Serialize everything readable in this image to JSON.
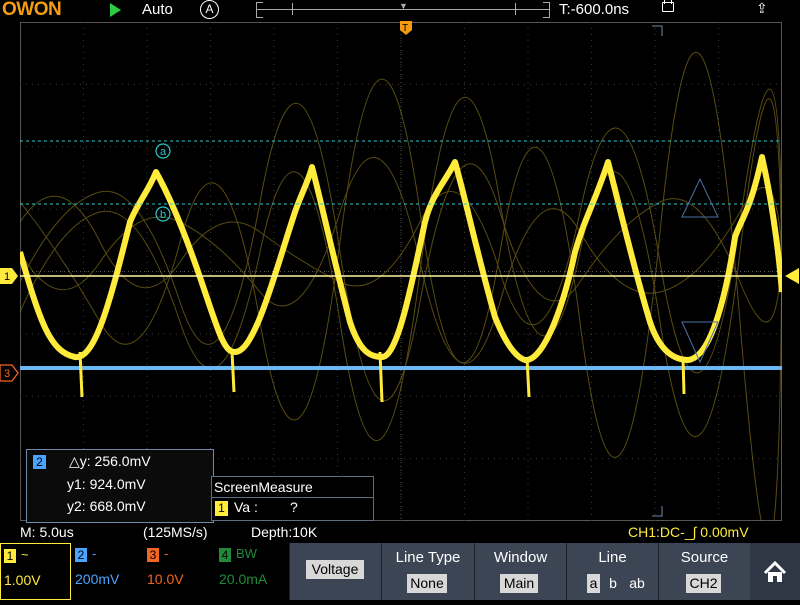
{
  "topbar": {
    "logo": "OWON",
    "trigger_mode": "Auto",
    "acquire_mode": "A",
    "trigger_position": "T:-600.0ns"
  },
  "markers": {
    "trigger": "T",
    "ch1": "1",
    "ch3": "3",
    "cursor_a": "a",
    "cursor_b": "b"
  },
  "cursor_readout": {
    "channel": "2",
    "dy": "△y: 256.0mV",
    "y1": "y1: 924.0mV",
    "y2": "y2: 668.0mV"
  },
  "screen_measure": {
    "title": "ScreenMeasure",
    "channel": "1",
    "label": "Va :",
    "value": "?"
  },
  "status": {
    "timebase": "M: 5.0us",
    "sample_rate": "(125MS/s)",
    "depth": "Depth:10K",
    "trigger_info": "CH1:DC-_∫ 0.00mV"
  },
  "channels": [
    {
      "num": "1",
      "coupling": "~",
      "scale": "1.00V",
      "color": "#ffeb3b"
    },
    {
      "num": "2",
      "coupling": "-",
      "scale": "200mV",
      "color": "#4aa3ff"
    },
    {
      "num": "3",
      "coupling": "-",
      "scale": "10.0V",
      "color": "#f26522"
    },
    {
      "num": "4",
      "coupling": "BW",
      "scale": "20.0mA",
      "color": "#1f8a3a"
    }
  ],
  "menu": {
    "voltage": "Voltage",
    "line_type": {
      "title": "Line Type",
      "value": "None"
    },
    "window": {
      "title": "Window",
      "value": "Main"
    },
    "line": {
      "title": "Line",
      "a": "a",
      "b": "b",
      "ab": "ab"
    },
    "source": {
      "title": "Source",
      "value": "CH2"
    }
  },
  "colors": {
    "ch1": "#ffeb3b",
    "ch2": "#4aa3ff",
    "ch3": "#f26522",
    "accent": "#f39c12",
    "cursor": "#2ec7c9",
    "menu_bg": "#3c4553"
  }
}
